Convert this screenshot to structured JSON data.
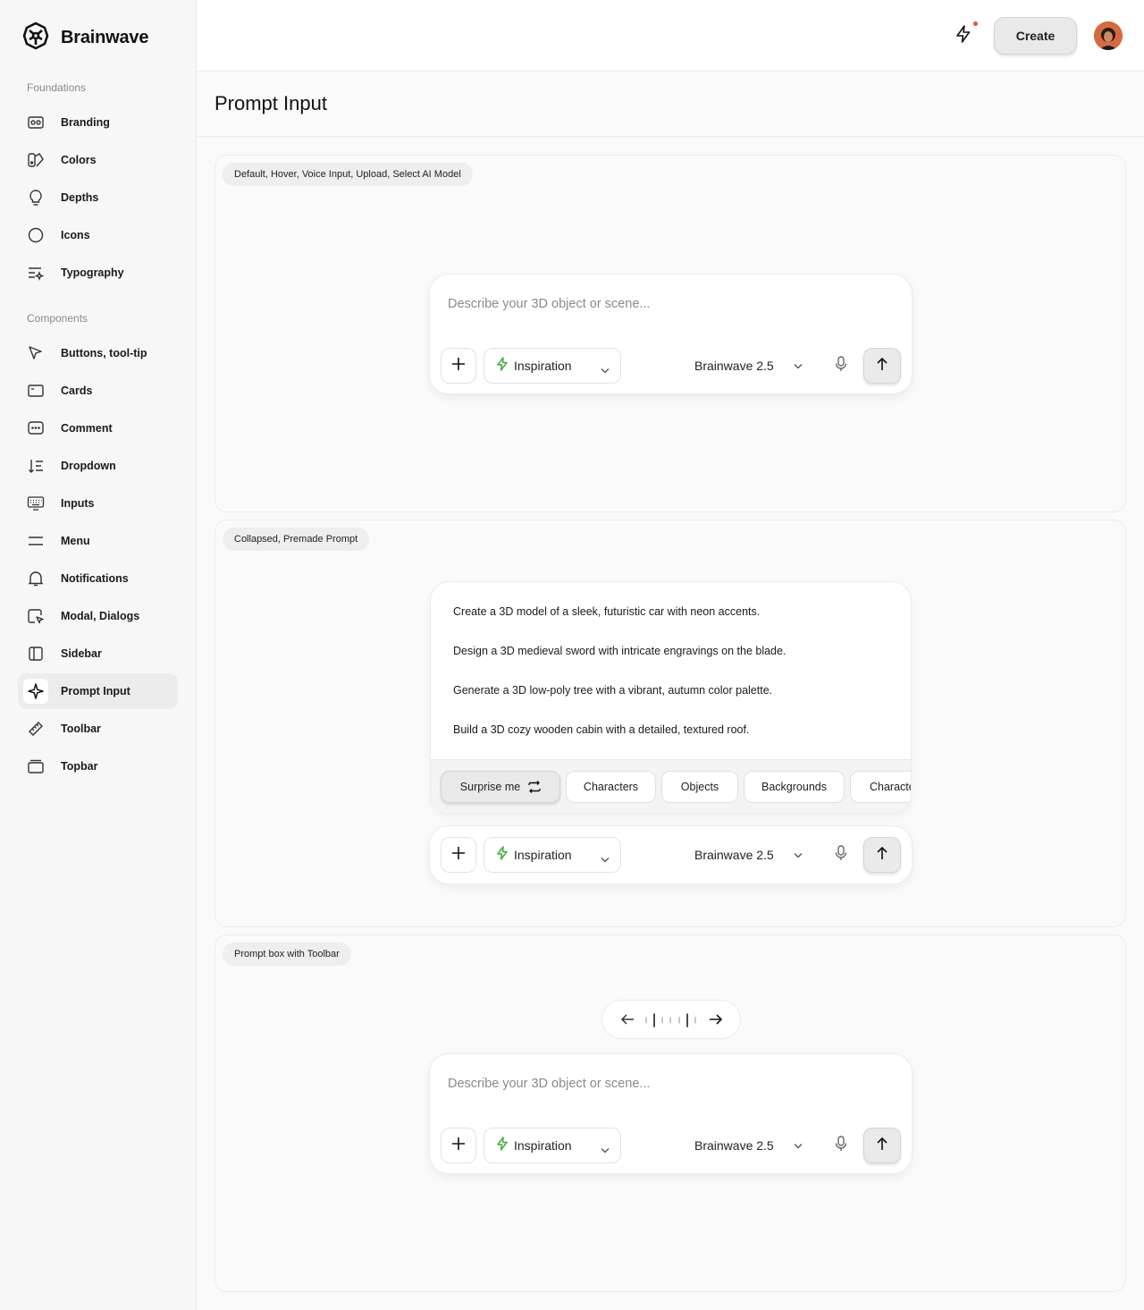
{
  "app": {
    "brand_name": "Brainwave"
  },
  "sidebar": {
    "foundations_label": "Foundations",
    "foundations": [
      {
        "label": "Branding",
        "icon": "branding-icon"
      },
      {
        "label": "Colors",
        "icon": "palette-icon"
      },
      {
        "label": "Depths",
        "icon": "bulb-icon"
      },
      {
        "label": "Icons",
        "icon": "circle-icon"
      },
      {
        "label": "Typography",
        "icon": "typography-icon"
      }
    ],
    "components_label": "Components",
    "components": [
      {
        "label": "Buttons, tool-tip",
        "icon": "cursor-icon"
      },
      {
        "label": "Cards",
        "icon": "card-icon"
      },
      {
        "label": "Comment",
        "icon": "comment-icon"
      },
      {
        "label": "Dropdown",
        "icon": "sort-icon"
      },
      {
        "label": "Inputs",
        "icon": "keyboard-icon"
      },
      {
        "label": "Menu",
        "icon": "menu-icon"
      },
      {
        "label": "Notifications",
        "icon": "bell-icon"
      },
      {
        "label": "Modal, Dialogs",
        "icon": "modal-icon"
      },
      {
        "label": "Sidebar",
        "icon": "sidebar-icon"
      },
      {
        "label": "Prompt Input",
        "icon": "sparkle-icon",
        "active": true
      },
      {
        "label": "Toolbar",
        "icon": "ruler-icon"
      },
      {
        "label": "Topbar",
        "icon": "topbar-icon"
      }
    ]
  },
  "topbar": {
    "create_label": "Create",
    "notification_dot_color": "#e5533d"
  },
  "page": {
    "title": "Prompt Input"
  },
  "panels": {
    "p1": {
      "tag": "Default, Hover, Voice Input, Upload, Select AI Model"
    },
    "p2": {
      "tag": "Collapsed, Premade Prompt"
    },
    "p3": {
      "tag": "Prompt box with Toolbar"
    }
  },
  "prompt": {
    "placeholder": "Describe your 3D object or scene...",
    "inspiration_label": "Inspiration",
    "model_label": "Brainwave 2.5",
    "accent_color": "#3fae3f"
  },
  "suggestions": [
    "Create a 3D model of a sleek, futuristic car with neon accents.",
    "Design a 3D medieval sword with intricate engravings on the blade.",
    "Generate a 3D low-poly tree with a vibrant, autumn color palette.",
    "Build a 3D cozy wooden cabin with a detailed, textured roof."
  ],
  "chips": [
    "Surprise me",
    "Characters",
    "Objects",
    "Backgrounds",
    "Characte"
  ]
}
